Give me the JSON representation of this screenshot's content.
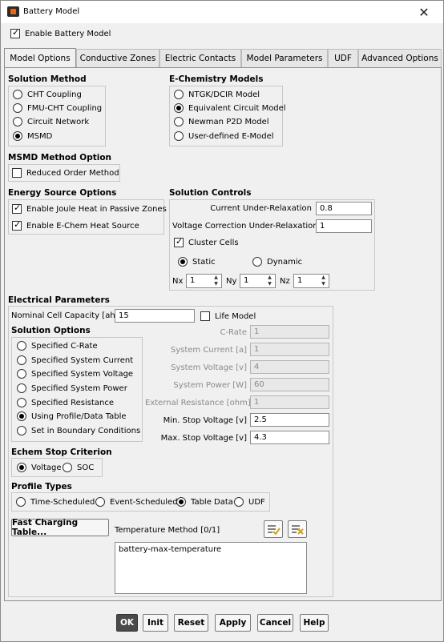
{
  "window": {
    "title": "Battery Model",
    "close_glyph": "✕"
  },
  "enable_battery_model": {
    "label": "Enable Battery Model",
    "checked": true
  },
  "tabs": [
    {
      "label": "Model Options",
      "active": true
    },
    {
      "label": "Conductive Zones",
      "active": false
    },
    {
      "label": "Electric Contacts",
      "active": false
    },
    {
      "label": "Model Parameters",
      "active": false
    },
    {
      "label": "UDF",
      "active": false
    },
    {
      "label": "Advanced Options",
      "active": false
    }
  ],
  "solution_method": {
    "title": "Solution Method",
    "options": [
      "CHT Coupling",
      "FMU-CHT Coupling",
      "Circuit Network",
      "MSMD"
    ],
    "selected": "MSMD"
  },
  "echem_models": {
    "title": "E-Chemistry Models",
    "options": [
      "NTGK/DCIR Model",
      "Equivalent Circuit Model",
      "Newman P2D Model",
      "User-defined E-Model"
    ],
    "selected": "Equivalent Circuit Model"
  },
  "msmd_method": {
    "title": "MSMD Method Option",
    "reduced_order": {
      "label": "Reduced Order Method",
      "checked": false
    }
  },
  "energy_source": {
    "title": "Energy Source Options",
    "joule_heat": {
      "label": "Enable Joule Heat in Passive Zones",
      "checked": true
    },
    "echem_heat": {
      "label": "Enable E-Chem Heat Source",
      "checked": true
    }
  },
  "solution_controls": {
    "title": "Solution Controls",
    "current_relax_label": "Current Under-Relaxation",
    "current_relax_value": "0.8",
    "voltage_relax_label": "Voltage Correction Under-Relaxation",
    "voltage_relax_value": "1",
    "cluster_cells": {
      "label": "Cluster Cells",
      "checked": true
    },
    "static_label": "Static",
    "dynamic_label": "Dynamic",
    "mode_selected": "Static",
    "nx_label": "Nx",
    "nx_value": "1",
    "ny_label": "Ny",
    "ny_value": "1",
    "nz_label": "Nz",
    "nz_value": "1"
  },
  "electrical": {
    "title": "Electrical Parameters",
    "capacity_label": "Nominal Cell Capacity [ah]",
    "capacity_value": "15",
    "life_model": {
      "label": "Life Model",
      "checked": false
    },
    "solution_options_title": "Solution Options",
    "options": [
      "Specified C-Rate",
      "Specified System Current",
      "Specified System Voltage",
      "Specified System Power",
      "Specified Resistance",
      "Using Profile/Data Table",
      "Set in Boundary Conditions"
    ],
    "selected": "Using Profile/Data Table",
    "crate_label": "C-Rate",
    "crate_value": "1",
    "sys_current_label": "System Current [a]",
    "sys_current_value": "1",
    "sys_voltage_label": "System Voltage [v]",
    "sys_voltage_value": "4",
    "sys_power_label": "System Power [W]",
    "sys_power_value": "60",
    "ext_res_label": "External Resistance [ohm]",
    "ext_res_value": "1",
    "min_stop_label": "Min. Stop Voltage [v]",
    "min_stop_value": "2.5",
    "max_stop_label": "Max. Stop Voltage [v]",
    "max_stop_value": "4.3"
  },
  "echem_stop": {
    "title": "Echem Stop Criterion",
    "options": [
      "Voltage",
      "SOC"
    ],
    "selected": "Voltage"
  },
  "profile_types": {
    "title": "Profile Types",
    "options": [
      "Time-Scheduled",
      "Event-Scheduled",
      "Table Data",
      "UDF"
    ],
    "selected": "Table Data"
  },
  "fast_charging_button": "Fast Charging Table...",
  "temperature_method": {
    "label": "Temperature Method",
    "count": "[0/1]",
    "items": [
      "battery-max-temperature"
    ]
  },
  "footer": {
    "ok": "OK",
    "init": "Init",
    "reset": "Reset",
    "apply": "Apply",
    "cancel": "Cancel",
    "help": "Help"
  },
  "colors": {
    "accent_orange": "#e06a1b",
    "select_all_check": "#d4a017",
    "deselect_x": "#d4a017"
  },
  "icons": {
    "app": "battery-model-app-icon",
    "select_all": "select-all-icon",
    "deselect_all": "deselect-all-icon"
  }
}
